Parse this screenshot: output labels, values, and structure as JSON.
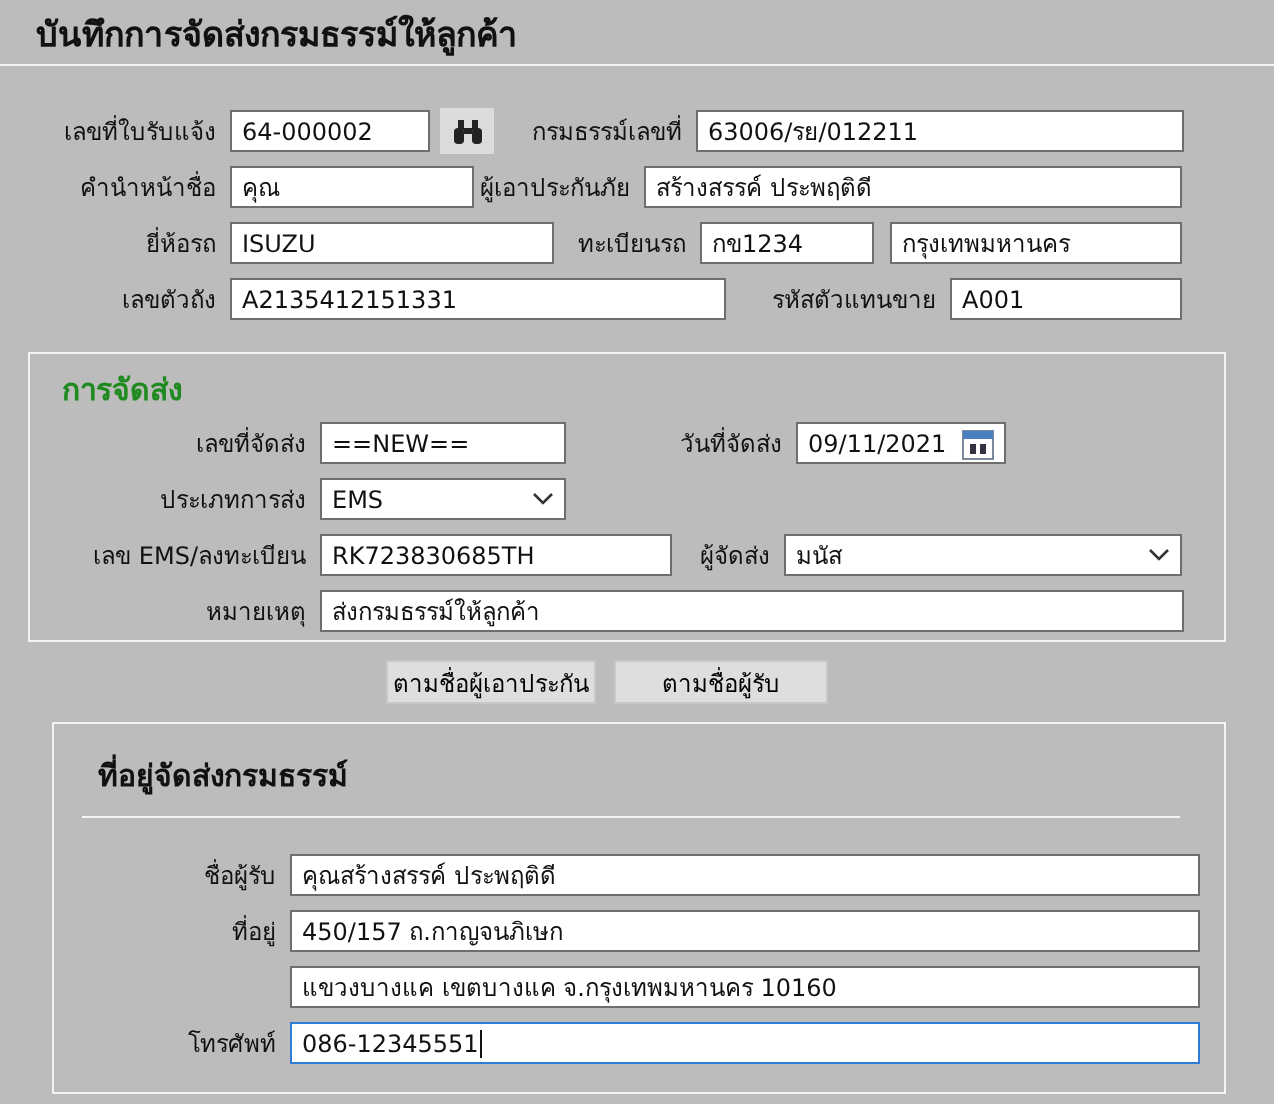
{
  "title": "บันทึกการจัดส่งกรมธรรม์ให้ลูกค้า",
  "policy_rows": [
    [
      {
        "label": "เลขที่ใบรับแจ้ง",
        "value": "64-000002",
        "kind": "search"
      },
      {
        "label": "กรมธรรม์เลขที่",
        "value": "63006/รย/012211",
        "kind": "text"
      }
    ],
    [
      {
        "label": "คำนำหน้าชื่อ",
        "value": "คุณ",
        "kind": "text"
      },
      {
        "label": "ผู้เอาประกันภัย",
        "value": "สร้างสรรค์  ประพฤติดี",
        "kind": "text"
      }
    ],
    [
      {
        "label": "ยี่ห้อรถ",
        "value": "ISUZU",
        "kind": "text"
      },
      {
        "label": "ทะเบียนรถ",
        "value": "กข1234",
        "kind": "text"
      },
      {
        "value": "กรุงเทพมหานคร",
        "kind": "text"
      }
    ],
    [
      {
        "label": "เลขตัวถัง",
        "value": "A2135412151331",
        "kind": "text"
      },
      {
        "label": "รหัสตัวแทนขาย",
        "value": "A001",
        "kind": "text"
      }
    ]
  ],
  "delivery": {
    "title": "การจัดส่ง",
    "rows": [
      [
        {
          "label": "เลขที่จัดส่ง",
          "value": "==NEW==",
          "kind": "text"
        },
        {
          "label": "วันที่จัดส่ง",
          "value": "09/11/2021",
          "kind": "date"
        }
      ],
      [
        {
          "label": "ประเภทการส่ง",
          "value": "EMS",
          "kind": "select"
        }
      ],
      [
        {
          "label": "เลข EMS/ลงทะเบียน",
          "value": "RK723830685TH",
          "kind": "text"
        },
        {
          "label": "ผู้จัดส่ง",
          "value": "มนัส",
          "kind": "select"
        }
      ],
      [
        {
          "label": "หมายเหตุ",
          "value": "ส่งกรมธรรม์ให้ลูกค้า",
          "kind": "text"
        }
      ]
    ]
  },
  "buttons": [
    "ตามชื่อผู้เอาประกัน",
    "ตามชื่อผู้รับ"
  ],
  "address": {
    "title": "ที่อยู่จัดส่งกรมธรรม์",
    "rows": [
      {
        "label": "ชื่อผู้รับ",
        "value": "คุณสร้างสรรค์  ประพฤติดี",
        "focused": false
      },
      {
        "label": "ที่อยู่",
        "value": "450/157 ถ.กาญจนภิเษก",
        "focused": false
      },
      {
        "value": "แขวงบางแค เขตบางแค จ.กรุงเทพมหานคร 10160",
        "focused": false
      },
      {
        "label": "โทรศัพท์",
        "value": "086-12345551",
        "focused": true
      }
    ]
  }
}
